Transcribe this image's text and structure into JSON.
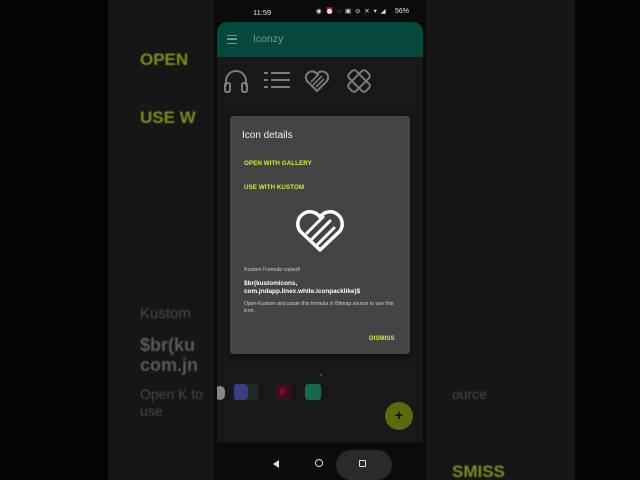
{
  "status_bar": {
    "time": "11:59",
    "icons": "◉  ⏰ ◌ ▣ ⊖ ✕ ▾ ◢",
    "battery": "56%"
  },
  "app_bar": {
    "title": "Iconzy"
  },
  "background": {
    "open": "OPEN",
    "use": "USE W",
    "kustom": "Kustom",
    "formula": "$br(ku com.jn",
    "open_k": "Open K to use",
    "source": "ource",
    "dismiss": "SMISS"
  },
  "dialog": {
    "title": "Icon details",
    "open_with_gallery": "OPEN WITH GALLERY",
    "use_with_kustom": "USE WITH KUSTOM",
    "copied_text": "Kustom Formula copied!",
    "formula": "$br(kustomicons, com.jndapp.linex.white.iconpacklike)$",
    "help_text": "Open Kustom and paste this formula in Bitmap source to use this icon.",
    "dismiss": "DISMISS"
  },
  "fab": {
    "label": "+"
  },
  "colors": {
    "app_bar": "#0c6f5f",
    "accent": "#d4ec2e",
    "fab": "#8aa516",
    "dialog_bg": "#444444"
  },
  "icons": {
    "grid": [
      "headphones-icon",
      "list-icon",
      "heart-icon",
      "bandage-icon"
    ],
    "dialog_icon": "heart-icon"
  }
}
